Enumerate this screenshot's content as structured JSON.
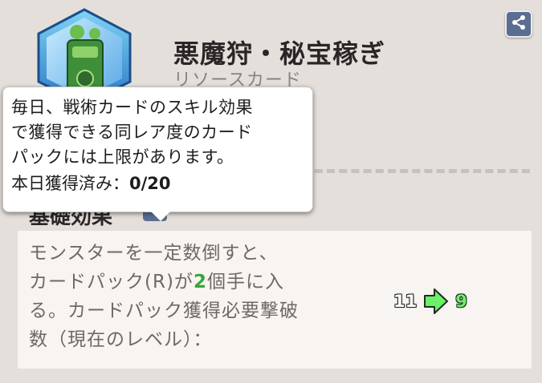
{
  "card": {
    "title": "悪魔狩・秘宝稼ぎ",
    "type": "リソースカード"
  },
  "tooltip": {
    "lines": [
      "毎日、戦術カードのスキル効果",
      "で獲得できる同レア度のカード",
      "パックには上限があります。"
    ],
    "count_label": "本日獲得済み：",
    "count_value": "0/20"
  },
  "section": {
    "heading": "基礎効果"
  },
  "effect": {
    "line1": "モンスターを一定数倒すと、",
    "line2_pre": "カードパック(R)が",
    "line2_num": "2",
    "line2_post": "個手に入",
    "line3": "る。カードパック獲得必要撃破",
    "line4": "数（現在のレベル）：",
    "level_old": "11",
    "level_new": "9"
  },
  "icons": {
    "share": "share-icon",
    "info": "info-icon",
    "arrow": "arrow-right-icon"
  },
  "colors": {
    "accent_green": "#38a63b",
    "button_blue": "#5b6d90"
  }
}
